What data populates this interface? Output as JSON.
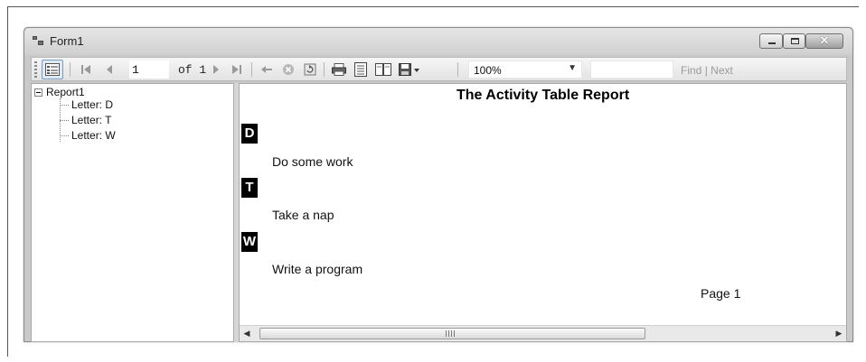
{
  "window": {
    "title": "Form1",
    "controls": [
      "minimize",
      "maximize",
      "close"
    ],
    "close_glyph": "✕"
  },
  "toolbar": {
    "document_map_icon": "document-map-icon",
    "current_page": "1",
    "of_pages": "of 1",
    "zoom_value": "100%",
    "find_label": "Find",
    "separator": "|",
    "next_label": "Next",
    "icons": [
      "first-page-icon",
      "previous-page-icon",
      "next-page-icon",
      "last-page-icon",
      "back-icon",
      "stop-icon",
      "refresh-icon",
      "print-icon",
      "print-layout-icon",
      "page-setup-icon",
      "export-icon"
    ]
  },
  "document_map": {
    "root": "Report1",
    "items": [
      {
        "label": "Letter: D"
      },
      {
        "label": "Letter: T"
      },
      {
        "label": "Letter: W"
      }
    ]
  },
  "report": {
    "title": "The Activity Table Report",
    "entries": [
      {
        "letter": "D",
        "activity": "Do some work"
      },
      {
        "letter": "T",
        "activity": "Take a nap"
      },
      {
        "letter": "W",
        "activity": "Write a program"
      }
    ],
    "page_label": "Page 1"
  },
  "colors": {
    "letter_background": "#000000",
    "letter_text": "#ffffff"
  }
}
